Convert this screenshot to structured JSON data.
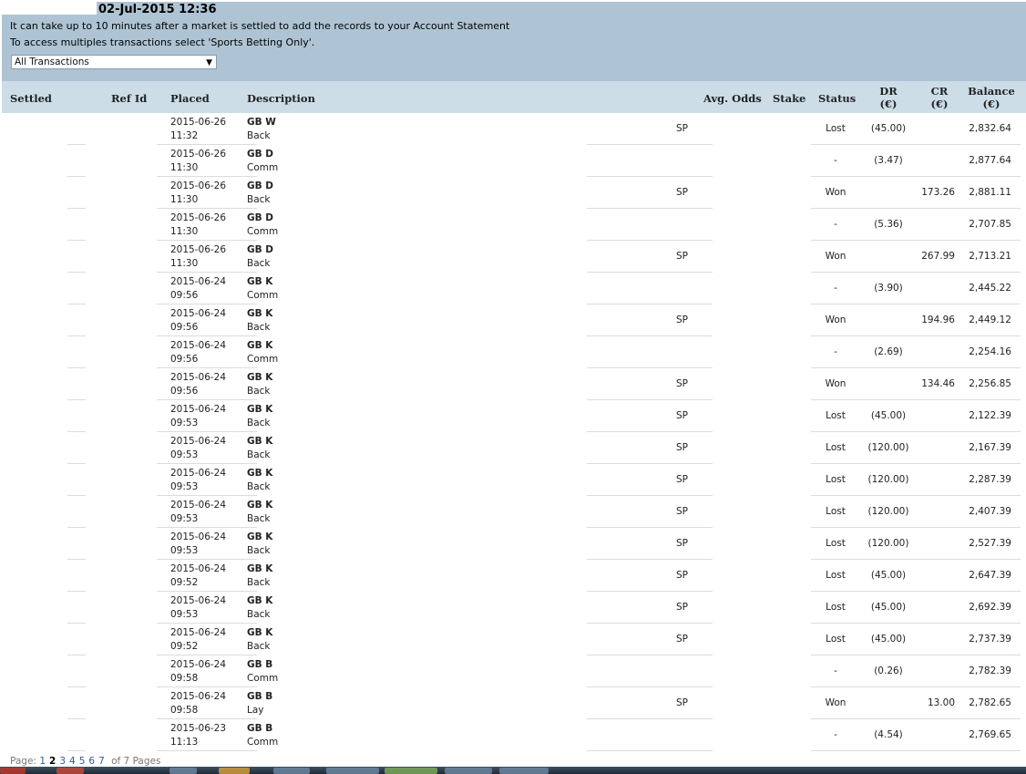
{
  "header": {
    "date": "02-Jul-2015 12:36",
    "info_line1": "It can take up to 10 minutes after a market is settled to add the records to your Account Statement",
    "info_line2": "To access multiples transactions select 'Sports Betting Only'.",
    "filter_value": "All Transactions"
  },
  "columns": {
    "settled": "Settled",
    "ref_id": "Ref Id",
    "placed": "Placed",
    "description": "Description",
    "avg_odds": "Avg. Odds",
    "stake": "Stake",
    "status": "Status",
    "dr": "DR",
    "dr_unit": "(€)",
    "cr": "CR",
    "cr_unit": "(€)",
    "balance": "Balance",
    "balance_unit": "(€)"
  },
  "rows": [
    {
      "date": "2015-06-26",
      "time": "11:32",
      "desc": "GB W",
      "type": "Back",
      "odds": "SP",
      "status": "Lost",
      "dr": "(45.00)",
      "cr": "",
      "balance": "2,832.64"
    },
    {
      "date": "2015-06-26",
      "time": "11:30",
      "desc": "GB D",
      "type": "Comm",
      "odds": "",
      "status": "-",
      "dr": "(3.47)",
      "cr": "",
      "balance": "2,877.64"
    },
    {
      "date": "2015-06-26",
      "time": "11:30",
      "desc": "GB D",
      "type": "Back",
      "odds": "SP",
      "status": "Won",
      "dr": "",
      "cr": "173.26",
      "balance": "2,881.11"
    },
    {
      "date": "2015-06-26",
      "time": "11:30",
      "desc": "GB D",
      "type": "Comm",
      "odds": "",
      "status": "-",
      "dr": "(5.36)",
      "cr": "",
      "balance": "2,707.85"
    },
    {
      "date": "2015-06-26",
      "time": "11:30",
      "desc": "GB D",
      "type": "Back",
      "odds": "SP",
      "status": "Won",
      "dr": "",
      "cr": "267.99",
      "balance": "2,713.21"
    },
    {
      "date": "2015-06-24",
      "time": "09:56",
      "desc": "GB K",
      "type": "Comm",
      "odds": "",
      "status": "-",
      "dr": "(3.90)",
      "cr": "",
      "balance": "2,445.22"
    },
    {
      "date": "2015-06-24",
      "time": "09:56",
      "desc": "GB K",
      "type": "Back",
      "odds": "SP",
      "status": "Won",
      "dr": "",
      "cr": "194.96",
      "balance": "2,449.12"
    },
    {
      "date": "2015-06-24",
      "time": "09:56",
      "desc": "GB K",
      "type": "Comm",
      "odds": "",
      "status": "-",
      "dr": "(2.69)",
      "cr": "",
      "balance": "2,254.16"
    },
    {
      "date": "2015-06-24",
      "time": "09:56",
      "desc": "GB K",
      "type": "Back",
      "odds": "SP",
      "status": "Won",
      "dr": "",
      "cr": "134.46",
      "balance": "2,256.85"
    },
    {
      "date": "2015-06-24",
      "time": "09:53",
      "desc": "GB K",
      "type": "Back",
      "odds": "SP",
      "status": "Lost",
      "dr": "(45.00)",
      "cr": "",
      "balance": "2,122.39"
    },
    {
      "date": "2015-06-24",
      "time": "09:53",
      "desc": "GB K",
      "type": "Back",
      "odds": "SP",
      "status": "Lost",
      "dr": "(120.00)",
      "cr": "",
      "balance": "2,167.39"
    },
    {
      "date": "2015-06-24",
      "time": "09:53",
      "desc": "GB K",
      "type": "Back",
      "odds": "SP",
      "status": "Lost",
      "dr": "(120.00)",
      "cr": "",
      "balance": "2,287.39"
    },
    {
      "date": "2015-06-24",
      "time": "09:53",
      "desc": "GB K",
      "type": "Back",
      "odds": "SP",
      "status": "Lost",
      "dr": "(120.00)",
      "cr": "",
      "balance": "2,407.39"
    },
    {
      "date": "2015-06-24",
      "time": "09:53",
      "desc": "GB K",
      "type": "Back",
      "odds": "SP",
      "status": "Lost",
      "dr": "(120.00)",
      "cr": "",
      "balance": "2,527.39"
    },
    {
      "date": "2015-06-24",
      "time": "09:52",
      "desc": "GB K",
      "type": "Back",
      "odds": "SP",
      "status": "Lost",
      "dr": "(45.00)",
      "cr": "",
      "balance": "2,647.39"
    },
    {
      "date": "2015-06-24",
      "time": "09:53",
      "desc": "GB K",
      "type": "Back",
      "odds": "SP",
      "status": "Lost",
      "dr": "(45.00)",
      "cr": "",
      "balance": "2,692.39"
    },
    {
      "date": "2015-06-24",
      "time": "09:52",
      "desc": "GB K",
      "type": "Back",
      "odds": "SP",
      "status": "Lost",
      "dr": "(45.00)",
      "cr": "",
      "balance": "2,737.39"
    },
    {
      "date": "2015-06-24",
      "time": "09:58",
      "desc": "GB B",
      "type": "Comm",
      "odds": "",
      "status": "-",
      "dr": "(0.26)",
      "cr": "",
      "balance": "2,782.39"
    },
    {
      "date": "2015-06-24",
      "time": "09:58",
      "desc": "GB B",
      "type": "Lay",
      "odds": "SP",
      "status": "Won",
      "dr": "",
      "cr": "13.00",
      "balance": "2,782.65"
    },
    {
      "date": "2015-06-23",
      "time": "11:13",
      "desc": "GB B",
      "type": "Comm",
      "odds": "",
      "status": "-",
      "dr": "(4.54)",
      "cr": "",
      "balance": "2,769.65"
    }
  ],
  "pager": {
    "label": "Page:",
    "pages": [
      "1",
      "2",
      "3",
      "4",
      "5",
      "6",
      "7"
    ],
    "current": "2",
    "total_text": "of 7 Pages"
  }
}
